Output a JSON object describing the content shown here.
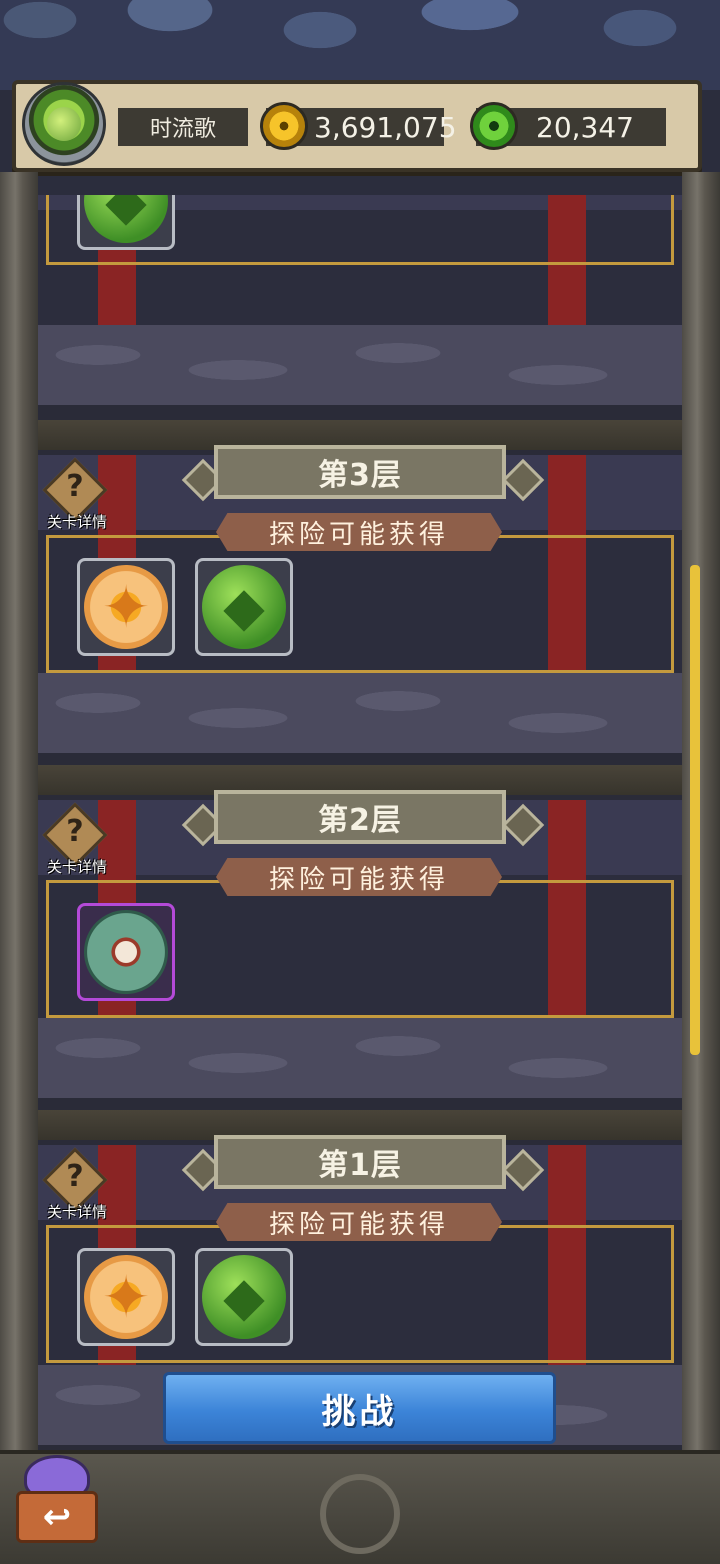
{
  "player": {
    "name": "时流歌",
    "gold": "3,691,075",
    "jade": "20,347"
  },
  "levels": [
    {
      "title": "第3层",
      "detail_label": "关卡详情",
      "reward_label": "探险可能获得",
      "items": [
        "compass-orb",
        "clover-orb"
      ]
    },
    {
      "title": "第2层",
      "detail_label": "关卡详情",
      "reward_label": "探险可能获得",
      "items": [
        "jade-talisman"
      ]
    },
    {
      "title": "第1层",
      "detail_label": "关卡详情",
      "reward_label": "探险可能获得",
      "items": [
        "compass-orb",
        "clover-orb"
      ]
    }
  ],
  "detail_symbol": "?",
  "challenge_label": "挑战",
  "back_symbol": "↩",
  "colors": {
    "title_bg": "#7a7664",
    "reward_label_bg": "#8e5f4a",
    "challenge_button": "#3c84d8",
    "reward_border": "#c49a3e"
  }
}
